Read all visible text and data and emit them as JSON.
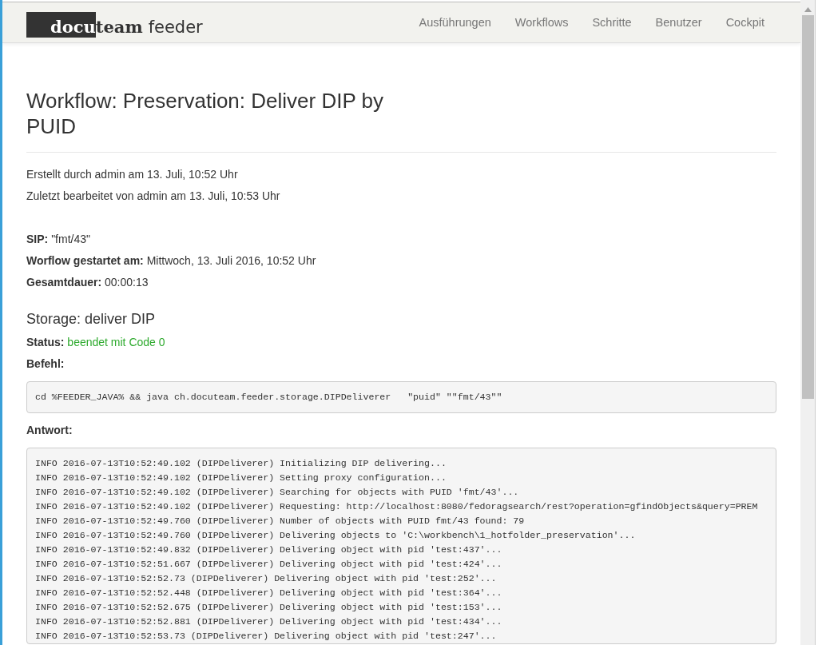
{
  "navbar": {
    "logo": {
      "dark_part": "docu",
      "bold_part": "team",
      "light_part": "feeder"
    },
    "items": [
      {
        "label": "Ausführungen",
        "selected": false
      },
      {
        "label": "Workflows",
        "selected": false
      },
      {
        "label": "Schritte",
        "selected": false
      },
      {
        "label": "Benutzer",
        "selected": false
      },
      {
        "label": "Cockpit",
        "selected": false
      }
    ]
  },
  "title": "Workflow: Preservation: Deliver DIP by PUID",
  "meta": [
    "Erstellt durch admin am 13. Juli, 10:52 Uhr",
    "Zuletzt bearbeitet von admin am 13. Juli, 10:53 Uhr"
  ],
  "fields": [
    {
      "label": "SIP:",
      "value": "\"fmt/43\""
    },
    {
      "label": "Worflow gestartet am:",
      "value": "Mittwoch, 13. Juli 2016, 10:52 Uhr"
    },
    {
      "label": "Gesamtdauer:",
      "value": "00:00:13"
    }
  ],
  "step": {
    "title": "Storage: deliver DIP",
    "status_label": "Status:",
    "status": "beendet mit Code 0",
    "command_label": "Befehl:",
    "command": "cd %FEEDER_JAVA% && java ch.docuteam.feeder.storage.DIPDeliverer   \"puid\" \"\"fmt/43\"\"",
    "response_label": "Antwort:",
    "log": [
      "INFO 2016-07-13T10:52:49.102 (DIPDeliverer) Initializing DIP delivering...",
      "INFO 2016-07-13T10:52:49.102 (DIPDeliverer) Setting proxy configuration...",
      "INFO 2016-07-13T10:52:49.102 (DIPDeliverer) Searching for objects with PUID 'fmt/43'...",
      "INFO 2016-07-13T10:52:49.102 (DIPDeliverer) Requesting: http://localhost:8080/fedoragsearch/rest?operation=gfindObjects&query=PREM",
      "INFO 2016-07-13T10:52:49.760 (DIPDeliverer) Number of objects with PUID fmt/43 found: 79",
      "INFO 2016-07-13T10:52:49.760 (DIPDeliverer) Delivering objects to 'C:\\workbench\\1_hotfolder_preservation'...",
      "INFO 2016-07-13T10:52:49.832 (DIPDeliverer) Delivering object with pid 'test:437'...",
      "INFO 2016-07-13T10:52:51.667 (DIPDeliverer) Delivering object with pid 'test:424'...",
      "INFO 2016-07-13T10:52:52.73 (DIPDeliverer) Delivering object with pid 'test:252'...",
      "INFO 2016-07-13T10:52:52.448 (DIPDeliverer) Delivering object with pid 'test:364'...",
      "INFO 2016-07-13T10:52:52.675 (DIPDeliverer) Delivering object with pid 'test:153'...",
      "INFO 2016-07-13T10:52:52.881 (DIPDeliverer) Delivering object with pid 'test:434'...",
      "INFO 2016-07-13T10:52:53.73 (DIPDeliverer) Delivering object with pid 'test:247'..."
    ]
  }
}
